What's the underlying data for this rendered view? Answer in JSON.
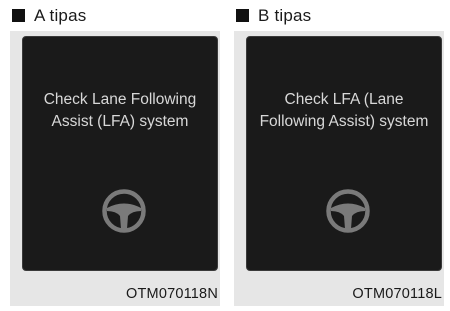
{
  "panels": [
    {
      "header": "A tipas",
      "message": "Check Lane Following\nAssist (LFA) system",
      "icon": "steering-wheel-icon",
      "code": "OTM070118N"
    },
    {
      "header": "B tipas",
      "message": "Check LFA (Lane\nFollowing Assist) system",
      "icon": "steering-wheel-icon",
      "code": "OTM070118L"
    }
  ],
  "colors": {
    "screen_bg": "#1a1a1a",
    "panel_bg": "#e6e6e6",
    "text_on_screen": "#d8d8d8",
    "icon_gray": "#7a7a7a"
  }
}
